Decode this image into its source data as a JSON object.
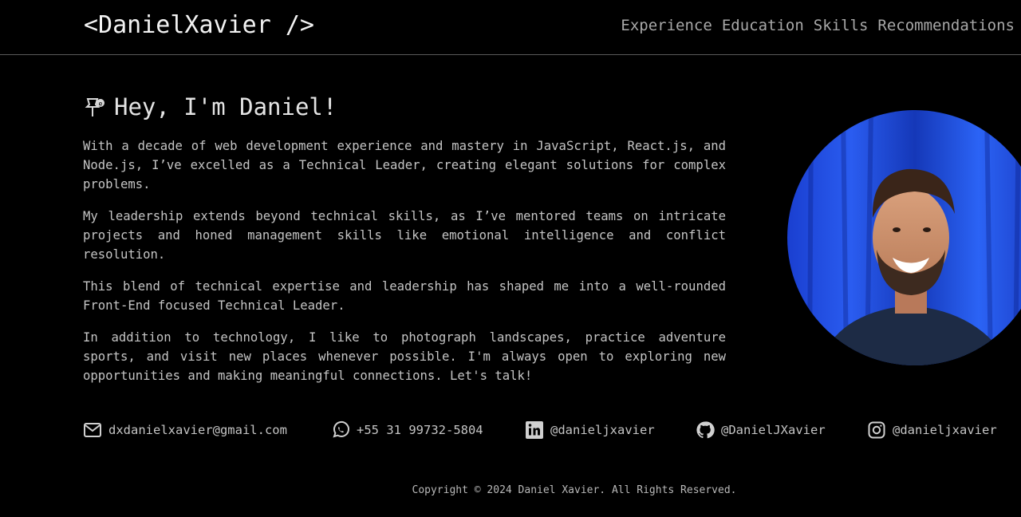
{
  "header": {
    "logo": "<DanielXavier />",
    "nav": [
      "Experience",
      "Education",
      "Skills",
      "Recommendations"
    ]
  },
  "hero": {
    "title": "Hey, I'm Daniel!",
    "icon": "pushpin-icon",
    "paragraphs": [
      "With a decade of web development experience and mastery in JavaScript, React.js, and Node.js, I’ve excelled as a Technical Leader, creating elegant solutions for complex problems.",
      "My leadership extends beyond technical skills, as I’ve mentored teams on intricate projects and honed management skills like emotional intelligence and conflict resolution.",
      "This blend of technical expertise and leadership has shaped me into a well-rounded Front-End focused Technical Leader.",
      "In addition to technology, I like to photograph landscapes, practice adventure sports, and visit new places whenever possible. I'm always open to exploring new opportunities and making meaningful connections. Let's talk!"
    ]
  },
  "contacts": [
    {
      "icon": "email-icon",
      "label": "dxdanielxavier@gmail.com"
    },
    {
      "icon": "whatsapp-icon",
      "label": "+55 31 99732-5804"
    },
    {
      "icon": "linkedin-icon",
      "label": "@danieljxavier"
    },
    {
      "icon": "github-icon",
      "label": "@DanielJXavier"
    },
    {
      "icon": "instagram-icon",
      "label": "@danieljxavier"
    }
  ],
  "footer": {
    "copyright": "Copyright © 2024 Daniel Xavier. All Rights Reserved."
  },
  "colors": {
    "background": "#000000",
    "text": "#c4c4c4",
    "accent_blue": "#1e4fd8"
  }
}
